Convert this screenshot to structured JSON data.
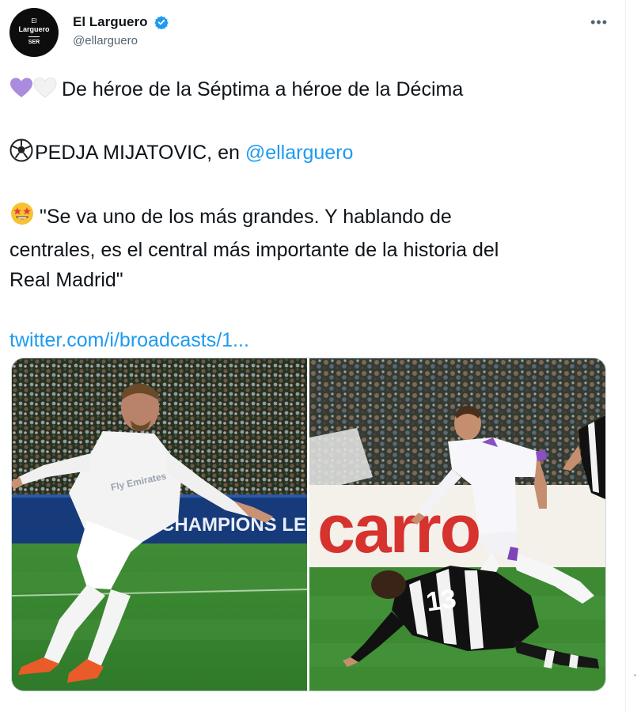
{
  "account": {
    "avatar_lines": [
      "El",
      "Larguero",
      "SER"
    ],
    "display_name": "El Larguero",
    "handle": "@ellarguero",
    "verified": true
  },
  "tweet": {
    "line1_emoji": [
      "purple-heart-icon",
      "white-heart-icon"
    ],
    "line1_text": "De héroe de la Séptima a héroe de la Décima",
    "line2_emoji": "soccer-ball-icon",
    "line2_text": "PEDJA MIJATOVIC, en ",
    "line2_mention": "@ellarguero",
    "line3_emoji": "star-struck-icon",
    "quote_lines": [
      "\"Se va uno de los más grandes. Y hablando de",
      "centrales, es el central más importante de la historia del",
      "Real Madrid\""
    ],
    "link_text": "twitter.com/i/broadcasts/1..."
  },
  "media": {
    "left_banner_text": "CHAMPIONS LE",
    "left_shirt_text": "Fly Emirates",
    "right_board_text": "carro",
    "right_shirt_number": "13"
  },
  "colors": {
    "link": "#1d9bf0",
    "verified": "#1d9bf0",
    "secondary_text": "#536471",
    "pitch": "#3d8a33"
  }
}
